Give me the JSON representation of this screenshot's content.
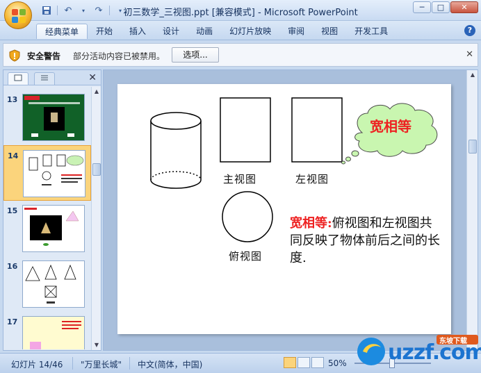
{
  "window": {
    "title": "初三数学_三视图.ppt [兼容模式] - Microsoft PowerPoint",
    "controls": [
      "─",
      "□",
      "✕"
    ]
  },
  "qat": {
    "save_icon": "save-icon",
    "undo_icon": "undo-icon",
    "redo_icon": "redo-icon"
  },
  "ribbon": {
    "tabs": [
      "经典菜单",
      "开始",
      "插入",
      "设计",
      "动画",
      "幻灯片放映",
      "审阅",
      "视图",
      "开发工具"
    ],
    "active_tab": "经典菜单",
    "help": "?"
  },
  "security": {
    "title": "安全警告",
    "message": "部分活动内容已被禁用。",
    "button": "选项...",
    "close": "✕"
  },
  "thumbnails": {
    "close": "✕",
    "items": [
      {
        "num": "13"
      },
      {
        "num": "14",
        "selected": true
      },
      {
        "num": "15"
      },
      {
        "num": "16"
      },
      {
        "num": "17"
      }
    ]
  },
  "slide": {
    "front_view": "主视图",
    "left_view": "左视图",
    "top_view": "俯视图",
    "callout": "宽相等",
    "desc_highlight": "宽相等:",
    "desc_text": "俯视图和左视图共同反映了物体前后之间的长度."
  },
  "statusbar": {
    "slide_pos": "幻灯片 14/46",
    "theme": "\"万里长城\"",
    "language": "中文(简体，中国)",
    "zoom": "50%"
  },
  "watermark": {
    "text": "uzzf.com",
    "subtext": "东坡下载"
  }
}
